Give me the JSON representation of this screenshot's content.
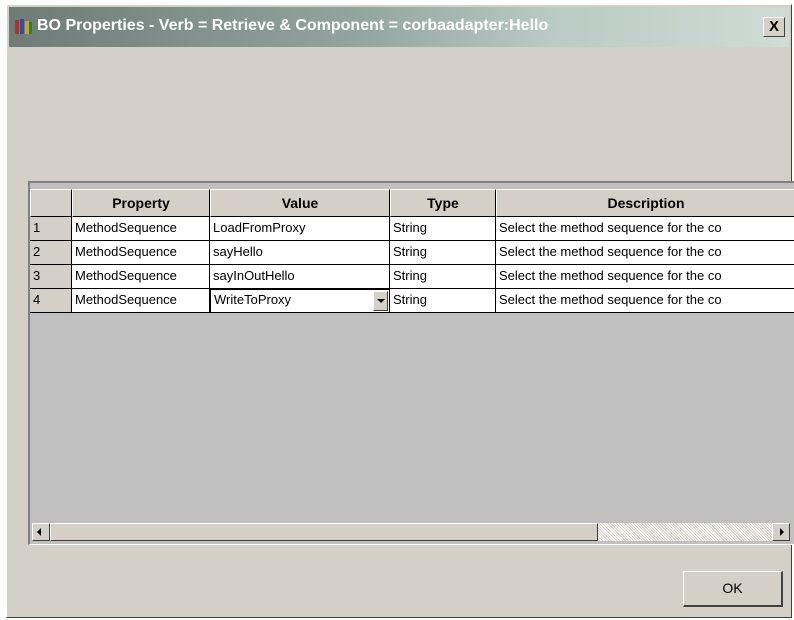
{
  "window": {
    "title": "BO Properties - Verb = Retrieve & Component = corbaadapter:Hello",
    "close_label": "X",
    "icon": "app-books-icon"
  },
  "grid": {
    "columns": [
      "",
      "Property",
      "Value",
      "Type",
      "Description"
    ],
    "rows": [
      {
        "num": "1",
        "property": "MethodSequence",
        "value": "LoadFromProxy",
        "type": "String",
        "description": "Select the method sequence for the co"
      },
      {
        "num": "2",
        "property": "MethodSequence",
        "value": "sayHello",
        "type": "String",
        "description": "Select the method sequence for the co"
      },
      {
        "num": "3",
        "property": "MethodSequence",
        "value": "sayInOutHello",
        "type": "String",
        "description": "Select the method sequence for the co"
      },
      {
        "num": "4",
        "property": "MethodSequence",
        "value": "WriteToProxy",
        "type": "String",
        "description": "Select the method sequence for the co"
      }
    ]
  },
  "buttons": {
    "ok": "OK"
  },
  "colors": {
    "titlebar_start": "#6f7b76",
    "titlebar_end": "#cfdcd6",
    "dialog_bg": "#d4d0c8"
  }
}
